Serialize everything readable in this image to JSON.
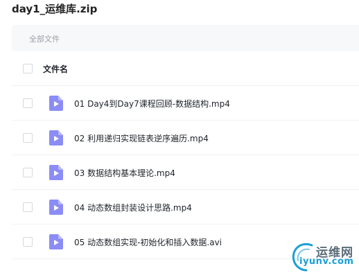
{
  "archive": {
    "title": "day1_运维库.zip"
  },
  "breadcrumb": {
    "label": "全部文件"
  },
  "table": {
    "header_label": "文件名",
    "files": [
      {
        "name": "01 Day4到Day7课程回顾-数据结构.mp4",
        "icon": "video-file-icon"
      },
      {
        "name": "02 利用递归实现链表逆序遍历.mp4",
        "icon": "video-file-icon"
      },
      {
        "name": "03 数据结构基本理论.mp4",
        "icon": "video-file-icon"
      },
      {
        "name": "04 动态数组封装设计思路.mp4",
        "icon": "video-file-icon"
      },
      {
        "name": "05 动态数组实现-初始化和插入数据.avi",
        "icon": "video-file-icon"
      }
    ]
  },
  "watermark": {
    "cn": "运维网",
    "en": "iyunv.com"
  },
  "colors": {
    "icon_purple": "#8b8cf5",
    "breadcrumb_bg": "#f7f8fa",
    "watermark_blue": "#1a9fd6"
  }
}
